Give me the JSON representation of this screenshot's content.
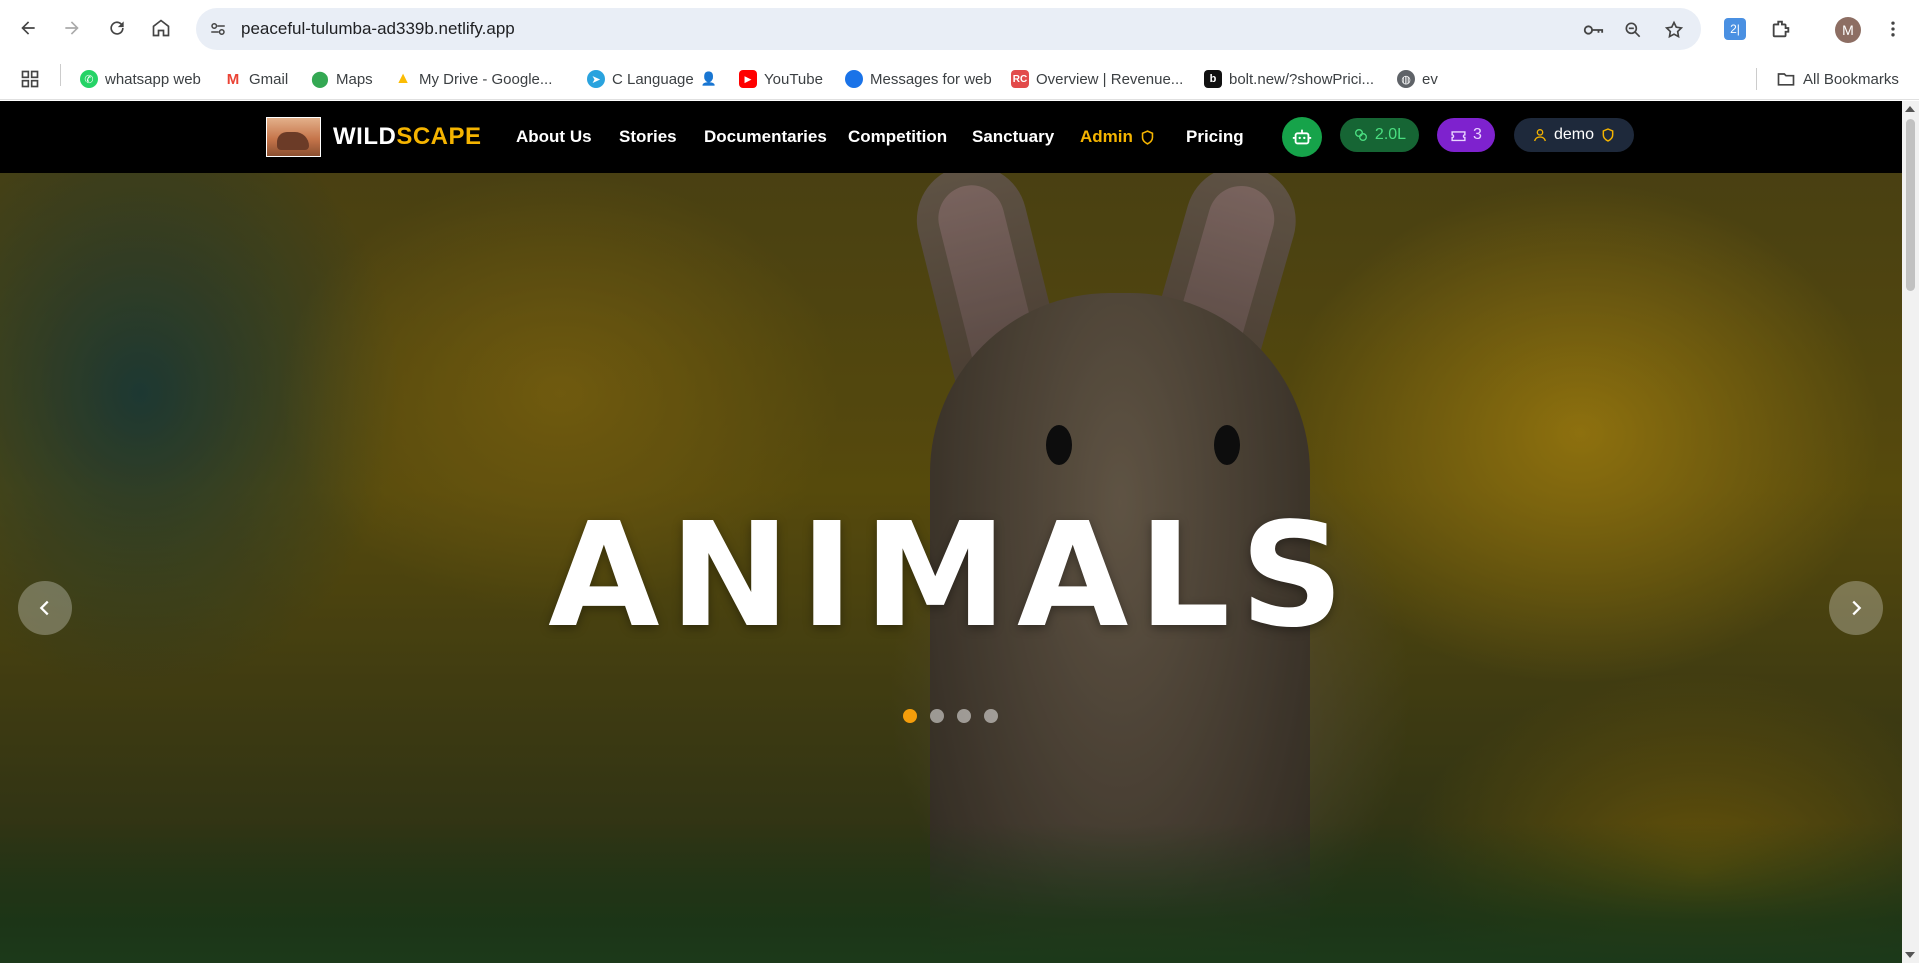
{
  "browser": {
    "url": "peaceful-tulumba-ad339b.netlify.app",
    "profile_initial": "M",
    "bookmarks": [
      {
        "label": "whatsapp web",
        "icon": "whatsapp-icon",
        "color": "#25d366"
      },
      {
        "label": "Gmail",
        "icon": "gmail-icon",
        "color": "#ea4335"
      },
      {
        "label": "Maps",
        "icon": "maps-icon",
        "color": "#34a853"
      },
      {
        "label": "My Drive - Google...",
        "icon": "drive-icon",
        "color": "#fbbc04"
      },
      {
        "label": "C Language",
        "icon": "telegram-icon",
        "color": "#2aa3de"
      },
      {
        "label": "YouTube",
        "icon": "youtube-icon",
        "color": "#ff0000"
      },
      {
        "label": "Messages for web",
        "icon": "messages-icon",
        "color": "#1a73e8"
      },
      {
        "label": "Overview | Revenue...",
        "icon": "revenuecat-icon",
        "color": "#e24b4b"
      },
      {
        "label": "bolt.new/?showPrici...",
        "icon": "bolt-icon",
        "color": "#111111"
      },
      {
        "label": "ev",
        "icon": "globe-icon",
        "color": "#5f6368"
      }
    ],
    "all_bookmarks": "All Bookmarks"
  },
  "site": {
    "logo": {
      "part1": "WILD",
      "part2": "SCAPE"
    },
    "nav": {
      "about": "About Us",
      "stories": "Stories",
      "documentaries": "Documentaries",
      "competition": "Competition",
      "sanctuary": "Sanctuary",
      "admin": "Admin",
      "pricing": "Pricing"
    },
    "coins": "2.0L",
    "tickets": "3",
    "user": "demo",
    "colors": {
      "accent": "#f5b400",
      "coins_bg": "#166534",
      "tickets_bg": "#7e22ce",
      "user_bg": "#1e293b",
      "bot_bg": "#16a34a",
      "active_dot": "#f59e0b"
    }
  },
  "hero": {
    "title": "ANIMALS",
    "slides": 4,
    "active_slide": 1
  }
}
